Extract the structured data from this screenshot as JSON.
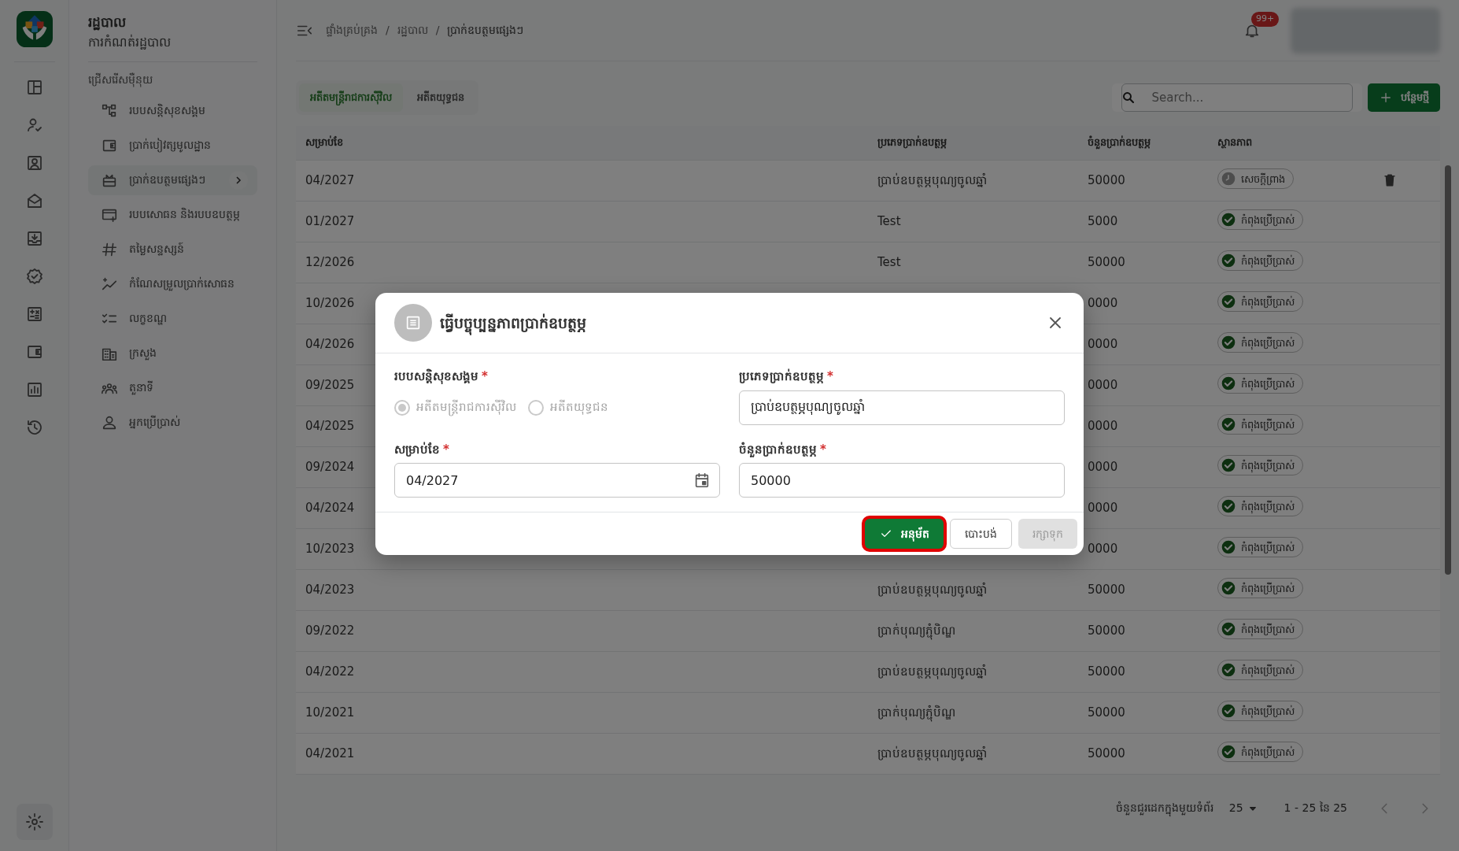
{
  "sidebar": {
    "title": "រដ្ឋបាល",
    "subtitle": "ការកំណត់រដ្ឋបាល",
    "section_label": "ជ្រើសរើសម៉ឺនុយ",
    "items": [
      {
        "label": "របបសន្តិសុខសង្គម",
        "selected": false
      },
      {
        "label": "ប្រាក់បៀវត្សមូលដ្ឋាន",
        "selected": false
      },
      {
        "label": "ប្រាក់ឧបត្ថមផ្សេងៗ",
        "selected": true
      },
      {
        "label": "របបសោធន និងរបបឧបត្ថម្ភ",
        "selected": false
      },
      {
        "label": "តម្លៃសន្ទស្សន៍",
        "selected": false
      },
      {
        "label": "កំណែសម្រួលប្រាក់សោធន",
        "selected": false
      },
      {
        "label": "លក្ខខណ្ឌ",
        "selected": false
      },
      {
        "label": "ក្រសួង",
        "selected": false
      },
      {
        "label": "តួនាទី",
        "selected": false
      },
      {
        "label": "អ្នកប្រើប្រាស់",
        "selected": false
      }
    ]
  },
  "header": {
    "breadcrumb": [
      "ផ្ទាំងគ្រប់គ្រង",
      "រដ្ឋបាល",
      "ប្រាក់ឧបត្ថមផ្សេងៗ"
    ],
    "separator": "/",
    "notification_badge": "99+"
  },
  "tabs": [
    {
      "label": "អតីតមន្ត្រីរាជការស៊ីវិល",
      "selected": true
    },
    {
      "label": "អតីតយុទ្ធជន",
      "selected": false
    }
  ],
  "search": {
    "placeholder": "Search..."
  },
  "add_button": "បន្ថែមថ្មី",
  "table": {
    "columns": [
      "សម្រាប់ខែ",
      "ប្រភេទប្រាក់ឧបត្ថម្ភ",
      "ចំនួនប្រាក់ឧបត្ថម្ភ",
      "ស្ថានភាព"
    ],
    "rows": [
      {
        "month": "04/2027",
        "type": "ប្រាប់ឧបត្ថម្ភបុណ្យចូលឆ្នាំ",
        "amount": "50000",
        "status": {
          "label": "សេចក្តីព្រាង",
          "kind": "draft"
        },
        "deletable": true
      },
      {
        "month": "01/2027",
        "type": "Test",
        "amount": "5000",
        "status": {
          "label": "កំពុងប្រើប្រាស់",
          "kind": "active"
        },
        "deletable": false
      },
      {
        "month": "12/2026",
        "type": "Test",
        "amount": "50000",
        "status": {
          "label": "កំពុងប្រើប្រាស់",
          "kind": "active"
        },
        "deletable": false
      },
      {
        "month": "10/2026",
        "amount": "0000",
        "status": {
          "label": "កំពុងប្រើប្រាស់",
          "kind": "active"
        },
        "deletable": false
      },
      {
        "month": "04/2026",
        "amount": "0000",
        "status": {
          "label": "កំពុងប្រើប្រាស់",
          "kind": "active"
        },
        "deletable": false
      },
      {
        "month": "09/2025",
        "amount": "0000",
        "status": {
          "label": "កំពុងប្រើប្រាស់",
          "kind": "active"
        },
        "deletable": false
      },
      {
        "month": "04/2025",
        "amount": "0000",
        "status": {
          "label": "កំពុងប្រើប្រាស់",
          "kind": "active"
        },
        "deletable": false
      },
      {
        "month": "09/2024",
        "amount": "0000",
        "status": {
          "label": "កំពុងប្រើប្រាស់",
          "kind": "active"
        },
        "deletable": false
      },
      {
        "month": "04/2024",
        "amount": "0000",
        "status": {
          "label": "កំពុងប្រើប្រាស់",
          "kind": "active"
        },
        "deletable": false
      },
      {
        "month": "10/2023",
        "amount": "0000",
        "status": {
          "label": "កំពុងប្រើប្រាស់",
          "kind": "active"
        },
        "deletable": false
      },
      {
        "month": "04/2023",
        "type": "ប្រាប់ឧបត្ថម្ភបុណ្យចូលឆ្នាំ",
        "amount": "50000",
        "status": {
          "label": "កំពុងប្រើប្រាស់",
          "kind": "active"
        },
        "deletable": false
      },
      {
        "month": "09/2022",
        "type": "ប្រាក់បុណ្យភ្ជុំបិណ្ឌ",
        "amount": "50000",
        "status": {
          "label": "កំពុងប្រើប្រាស់",
          "kind": "active"
        },
        "deletable": false
      },
      {
        "month": "04/2022",
        "type": "ប្រាប់ឧបត្ថម្ភបុណ្យចូលឆ្នាំ",
        "amount": "50000",
        "status": {
          "label": "កំពុងប្រើប្រាស់",
          "kind": "active"
        },
        "deletable": false
      },
      {
        "month": "10/2021",
        "type": "ប្រាក់បុណ្យភ្ជុំបិណ្ឌ",
        "amount": "50000",
        "status": {
          "label": "កំពុងប្រើប្រាស់",
          "kind": "active"
        },
        "deletable": false
      },
      {
        "month": "04/2021",
        "type": "ប្រាប់ឧបត្ថម្ភបុណ្យចូលឆ្នាំ",
        "amount": "50000",
        "status": {
          "label": "កំពុងប្រើប្រាស់",
          "kind": "active"
        },
        "deletable": false
      }
    ]
  },
  "pagination": {
    "rows_per_page_label": "ចំនួនជួរដេកក្នុងមួយទំព័រ",
    "rows_per_page": "25",
    "range": "1 - 25 នៃ 25"
  },
  "modal": {
    "title": "ធ្វើបច្ចុប្បន្នភាពប្រាក់ឧបត្ថម្ភ",
    "required_mark": "*",
    "scheme": {
      "label": "របបសន្តិសុខសង្គម",
      "required": true,
      "disabled": true,
      "options": [
        {
          "label": "អតីតមន្ត្រីរាជការស៊ីវិល",
          "selected": true
        },
        {
          "label": "អតីតយុទ្ធជន",
          "selected": false
        }
      ]
    },
    "type_field": {
      "label": "ប្រភេទប្រាក់ឧបត្ថម្ភ",
      "required": true,
      "value": "ប្រាប់ឧបត្ថម្ភបុណ្យចូលឆ្នាំ"
    },
    "month_field": {
      "label": "សម្រាប់ខែ",
      "required": true,
      "value": "04/2027"
    },
    "amount_field": {
      "label": "ចំនួនប្រាក់ឧបត្ថម្ភ",
      "required": true,
      "value": "50000"
    },
    "buttons": [
      {
        "label": "អនុម័ត",
        "kind": "primary",
        "highlighted": true
      },
      {
        "label": "បោះបង់",
        "kind": "outline",
        "highlighted": false
      },
      {
        "label": "រក្សាទុក",
        "kind": "disabled",
        "highlighted": false
      }
    ]
  }
}
